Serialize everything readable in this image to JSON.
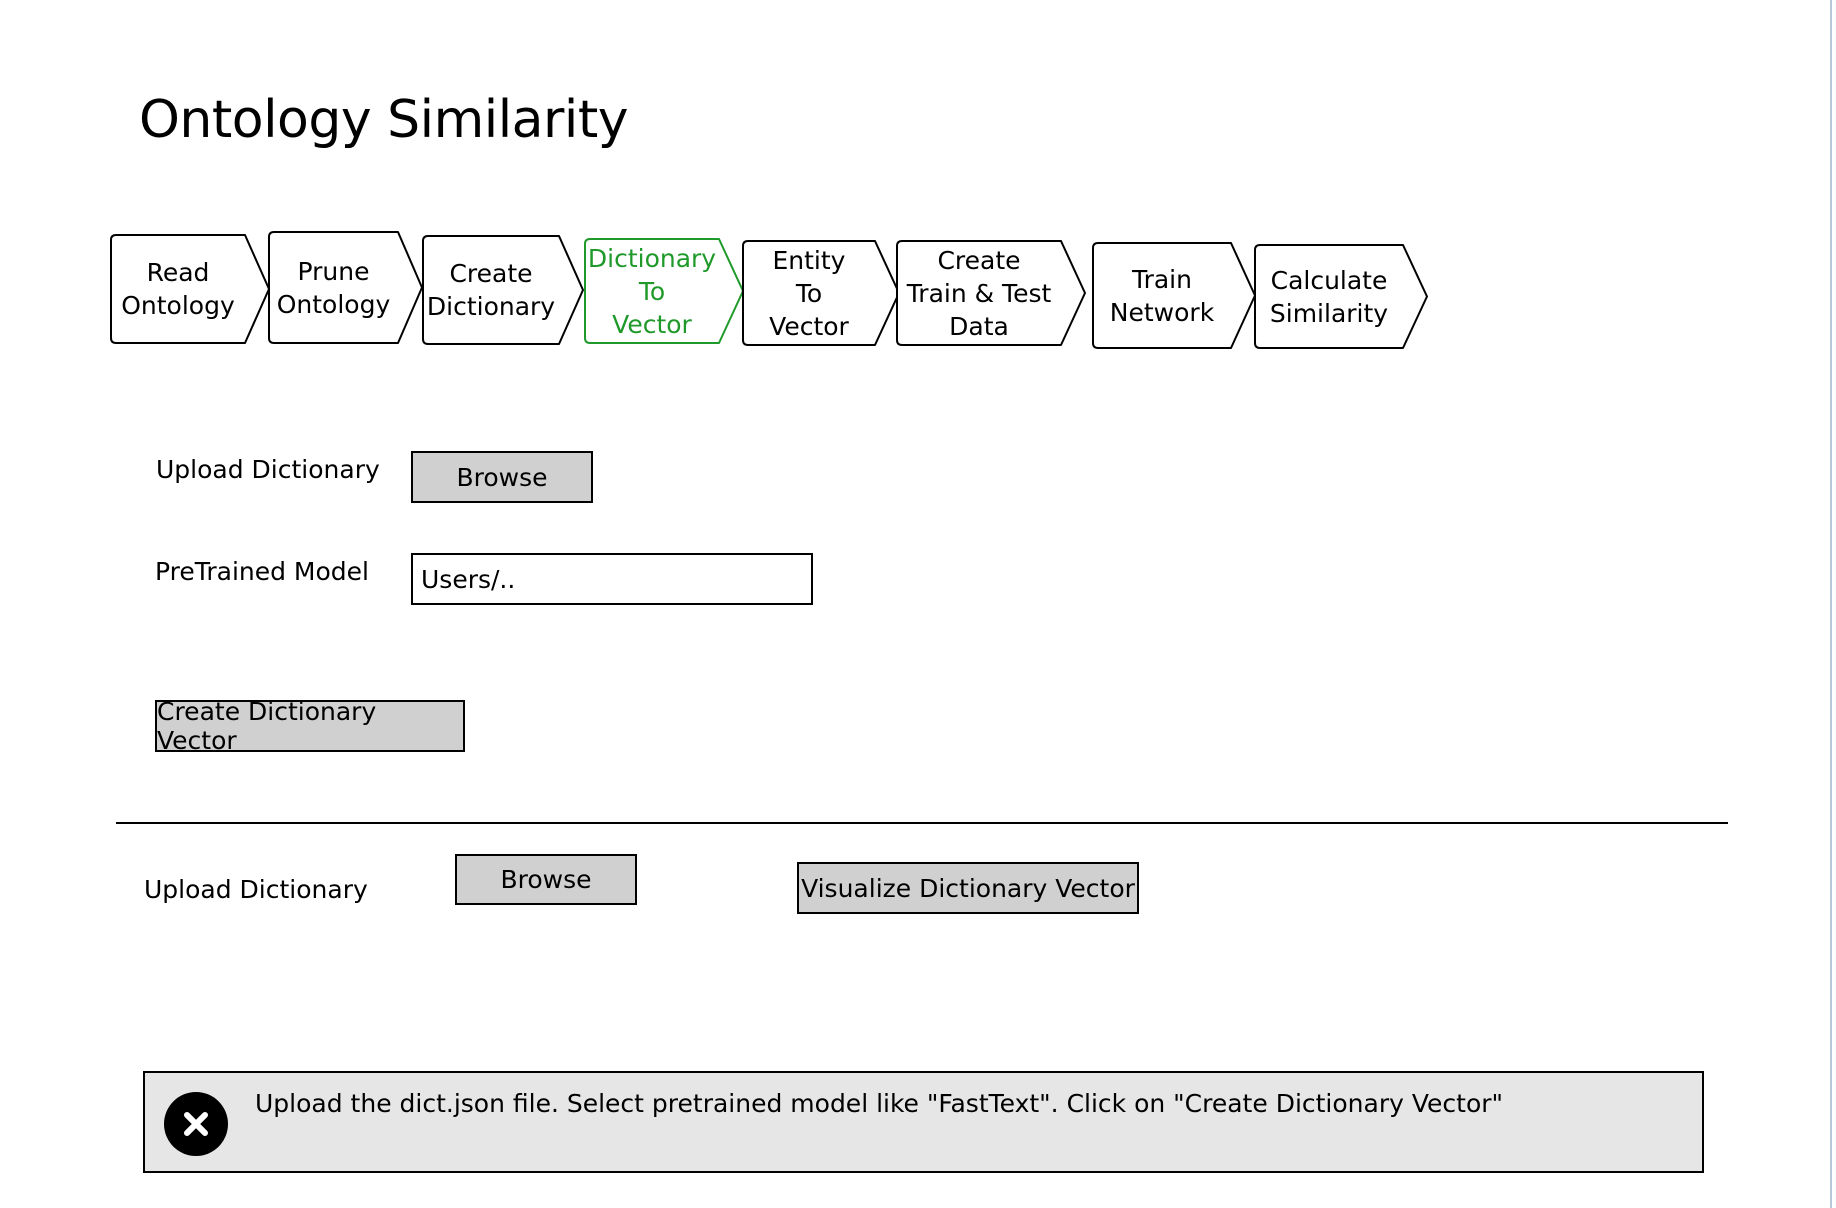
{
  "page": {
    "title": "Ontology Similarity"
  },
  "workflow": {
    "active_index": 3,
    "active_color": "#1f9a2a",
    "steps": [
      {
        "label": "Read\nOntology"
      },
      {
        "label": "Prune\nOntology"
      },
      {
        "label": "Create\nDictionary"
      },
      {
        "label": "Dictionary\nTo\nVector"
      },
      {
        "label": "Entity\nTo\nVector"
      },
      {
        "label": "Create\nTrain & Test\nData"
      },
      {
        "label": "Train\nNetwork"
      },
      {
        "label": "Calculate\nSimilarity"
      }
    ]
  },
  "create_section": {
    "upload_label": "Upload Dictionary",
    "browse_label": "Browse",
    "model_label": "PreTrained Model",
    "model_value": "Users/..",
    "create_button": "Create Dictionary Vector"
  },
  "visualize_section": {
    "upload_label": "Upload Dictionary",
    "browse_label": "Browse",
    "visualize_button": "Visualize Dictionary Vector"
  },
  "notice": {
    "icon": "close-icon",
    "text": "Upload the dict.json file. Select pretrained model like \"FastText\". Click on \"Create Dictionary Vector\""
  }
}
